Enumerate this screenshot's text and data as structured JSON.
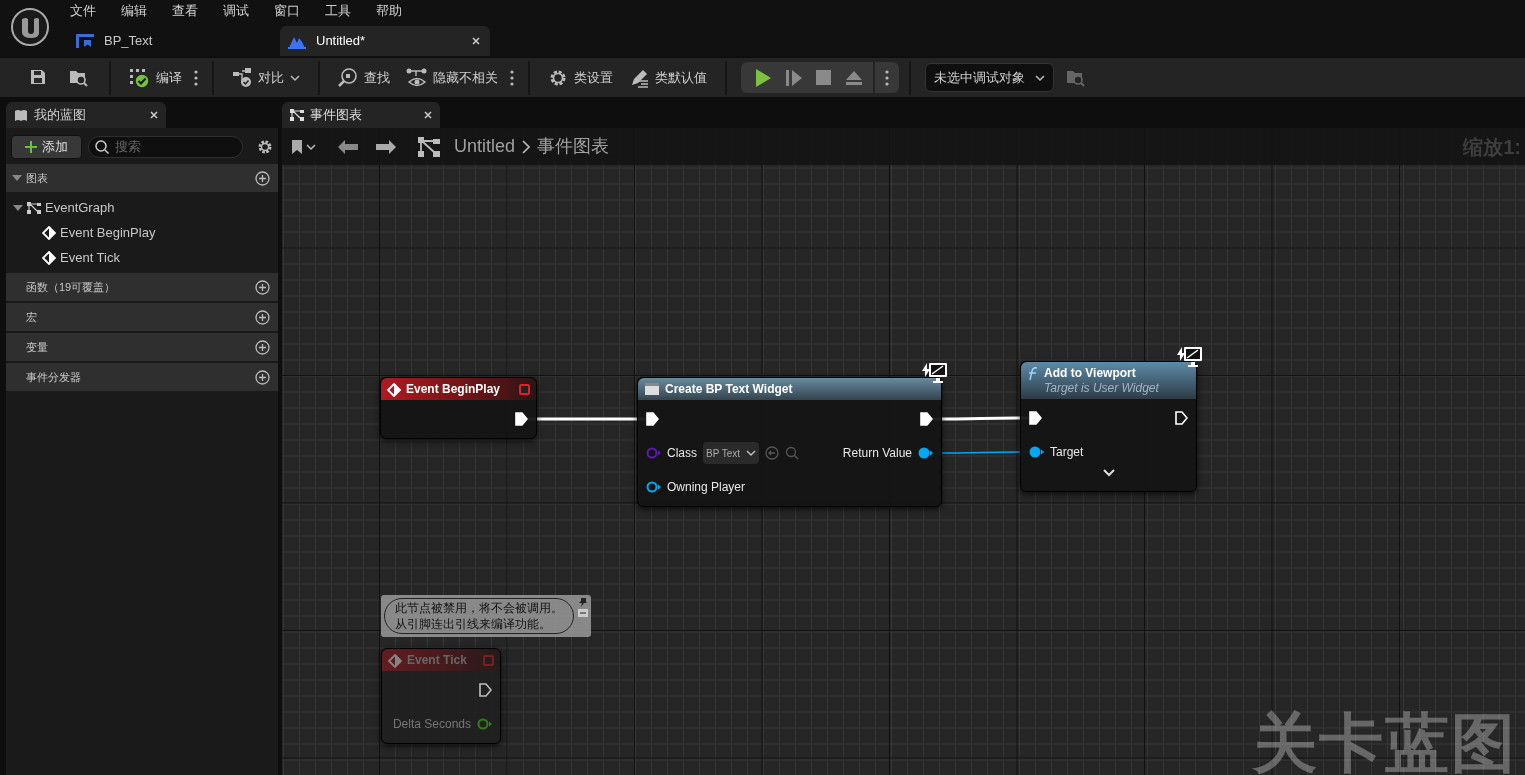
{
  "menu": [
    "文件",
    "编辑",
    "查看",
    "调试",
    "窗口",
    "工具",
    "帮助"
  ],
  "document_tabs": [
    {
      "label": "BP_Text",
      "selected": false
    },
    {
      "label": "Untitled*",
      "selected": true
    }
  ],
  "toolbar": {
    "items": [
      {
        "kind": "icon"
      },
      {
        "kind": "icon"
      },
      {
        "kind": "button",
        "label": "编译",
        "more": true
      },
      {
        "kind": "dropdown",
        "label": "对比"
      },
      {
        "kind": "button",
        "label": "查找",
        "more": false
      },
      {
        "kind": "button",
        "label": "隐藏不相关",
        "more": true
      },
      {
        "kind": "button",
        "label": "类设置",
        "more": false
      },
      {
        "kind": "button",
        "label": "类默认值",
        "more": false
      }
    ],
    "play_controls": [
      {
        "disabled": false
      },
      {
        "disabled": true
      },
      {
        "disabled": true
      },
      {
        "disabled": true
      }
    ],
    "debug_object": "未选中调试对象"
  },
  "my_blueprint": {
    "title": "我的蓝图",
    "add_button": "添加",
    "search": {
      "placeholder": "搜索"
    },
    "sections": [
      {
        "label": "图表",
        "expanded": true,
        "children": [
          {
            "label": "EventGraph",
            "expanded": true,
            "children": [
              {
                "label": "Event BeginPlay"
              },
              {
                "label": "Event Tick"
              }
            ]
          }
        ]
      },
      {
        "label": "函数（19可覆盖）",
        "expanded": false
      },
      {
        "label": "宏",
        "expanded": false
      },
      {
        "label": "变量",
        "expanded": false
      },
      {
        "label": "事件分发器",
        "expanded": false
      }
    ]
  },
  "graph": {
    "tab": "事件图表",
    "breadcrumb": [
      "Untitled",
      "事件图表"
    ],
    "zoom": "缩放1:",
    "watermark": "关卡蓝图",
    "nodes": [
      {
        "kind": "event",
        "title": "Event BeginPlay",
        "disabled": false,
        "client_only": false,
        "advanced_collapsed": false,
        "rows": [
          {
            "right": {
              "kind": "exec",
              "connected": true
            }
          }
        ]
      },
      {
        "kind": "create",
        "title": "Create BP Text Widget",
        "disabled": false,
        "client_only": true,
        "advanced_collapsed": false,
        "rows": [
          {
            "left": {
              "kind": "exec",
              "connected": true
            },
            "right": {
              "kind": "exec",
              "connected": true
            }
          },
          {
            "left": {
              "kind": "class",
              "label": "Class",
              "connected": false,
              "value": "BP Text"
            },
            "right": {
              "kind": "object",
              "label": "Return Value",
              "connected": true
            }
          },
          {
            "left": {
              "kind": "object",
              "label": "Owning Player",
              "connected": false
            }
          }
        ]
      },
      {
        "kind": "function",
        "title": "Add to Viewport",
        "subtitle": "Target is User Widget",
        "disabled": false,
        "client_only": true,
        "advanced_collapsed": true,
        "rows": [
          {
            "left": {
              "kind": "exec",
              "connected": true
            },
            "right": {
              "kind": "exec",
              "connected": false
            }
          },
          {
            "left": {
              "kind": "object",
              "label": "Target",
              "connected": true
            }
          }
        ]
      },
      {
        "kind": "event",
        "title": "Event Tick",
        "disabled": true,
        "client_only": false,
        "advanced_collapsed": false,
        "comment": "此节点被禁用，将不会被调用。从引脚连出引线来编译功能。",
        "rows": [
          {
            "right": {
              "kind": "exec",
              "connected": false
            }
          },
          {
            "right": {
              "kind": "float",
              "label": "Delta Seconds",
              "connected": false
            }
          }
        ]
      }
    ]
  }
}
